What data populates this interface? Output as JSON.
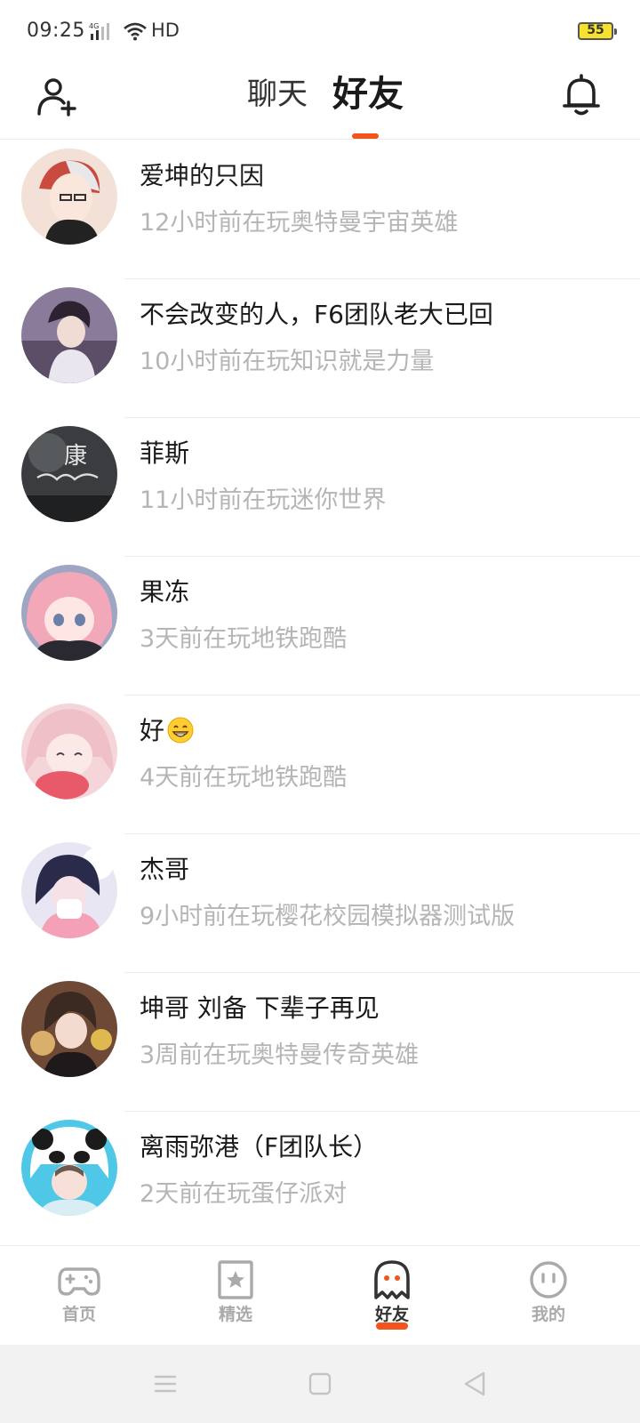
{
  "status_bar": {
    "time": "09:25",
    "network": "4G",
    "hd": "HD",
    "battery": "55",
    "battery_color": "#f5e12e"
  },
  "header": {
    "add_friend_icon": "add-user-icon",
    "tab_chat": "聊天",
    "tab_friends": "好友",
    "notification_icon": "bell-icon",
    "accent_color": "#f2541b"
  },
  "friends": [
    {
      "name": "爱坤的只因",
      "status": "12小时前在玩奥特曼宇宙英雄"
    },
    {
      "name": "不会改变的人，F6团队老大已回",
      "status": "10小时前在玩知识就是力量"
    },
    {
      "name": "菲斯",
      "status": "11小时前在玩迷你世界"
    },
    {
      "name": "果冻",
      "status": "3天前在玩地铁跑酷"
    },
    {
      "name": "好",
      "name_emoji": "grinning-face-emoji",
      "status": "4天前在玩地铁跑酷"
    },
    {
      "name": "杰哥",
      "status": "9小时前在玩樱花校园模拟器测试版"
    },
    {
      "name": "坤哥  刘备  下辈子再见",
      "status": "3周前在玩奥特曼传奇英雄"
    },
    {
      "name": "离雨弥港（F团队长）",
      "status": "2天前在玩蛋仔派对"
    }
  ],
  "bottom_nav": {
    "items": [
      {
        "label": "首页",
        "icon": "gamepad-icon"
      },
      {
        "label": "精选",
        "icon": "star-bookmark-icon"
      },
      {
        "label": "好友",
        "icon": "ghost-icon",
        "active": true
      },
      {
        "label": "我的",
        "icon": "face-icon"
      }
    ]
  },
  "system_nav": {
    "icons": [
      "menu-icon",
      "home-square-icon",
      "back-triangle-icon"
    ]
  }
}
